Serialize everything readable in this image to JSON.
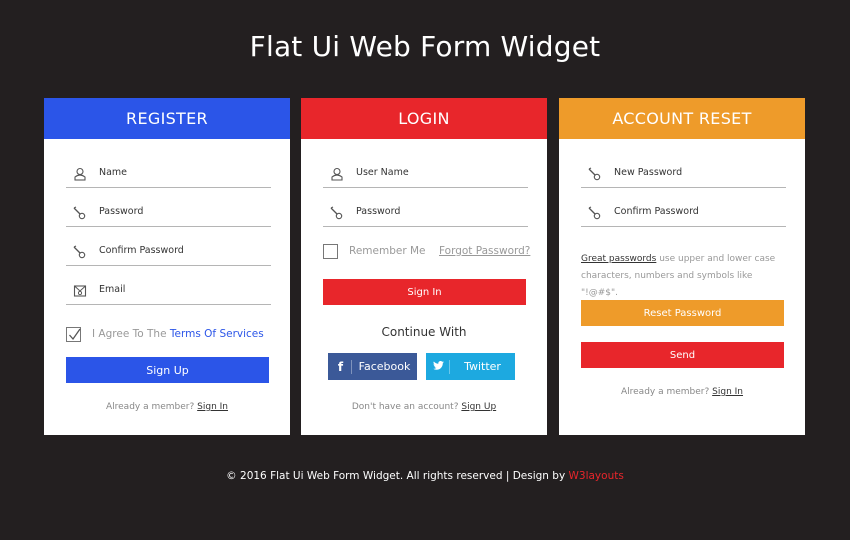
{
  "page": {
    "title": "Flat Ui Web Form Widget"
  },
  "colors": {
    "background": "#231f20",
    "register": "#2b55e8",
    "login": "#e8262b",
    "reset": "#ee9b2a",
    "facebook": "#3b5998",
    "twitter": "#1da9e0"
  },
  "register": {
    "title": "REGISTER",
    "fields": [
      {
        "placeholder": "Name",
        "icon": "user-icon"
      },
      {
        "placeholder": "Password",
        "icon": "key-icon"
      },
      {
        "placeholder": "Confirm Password",
        "icon": "key-icon"
      },
      {
        "placeholder": "Email",
        "icon": "email-icon"
      }
    ],
    "agree_checked": true,
    "agree_text": "I Agree To The",
    "terms_link": "Terms Of Services",
    "submit_label": "Sign Up",
    "footer_text": "Already a member?",
    "footer_link": "Sign In"
  },
  "login": {
    "title": "LOGIN",
    "fields": [
      {
        "placeholder": "User Name",
        "icon": "user-icon"
      },
      {
        "placeholder": "Password",
        "icon": "key-icon"
      }
    ],
    "remember_checked": false,
    "remember_label": "Remember Me",
    "forgot_link": "Forgot Password?",
    "submit_label": "Sign In",
    "continue_with": "Continue With",
    "facebook_label": "Facebook",
    "twitter_label": "Twitter",
    "footer_text": "Don't have an account?",
    "footer_link": "Sign Up"
  },
  "reset": {
    "title": "ACCOUNT RESET",
    "fields": [
      {
        "placeholder": "New Password",
        "icon": "key-icon"
      },
      {
        "placeholder": "Confirm Password",
        "icon": "key-icon"
      }
    ],
    "hint_link": "Great passwords",
    "hint_text": "use upper and lower case characters, numbers and symbols like \"!@#$\".",
    "reset_label": "Reset Password",
    "send_label": "Send",
    "footer_text": "Already a member?",
    "footer_link": "Sign In"
  },
  "footer": {
    "text": "© 2016 Flat Ui Web Form Widget. All rights reserved | Design by",
    "link": "W3layouts"
  }
}
